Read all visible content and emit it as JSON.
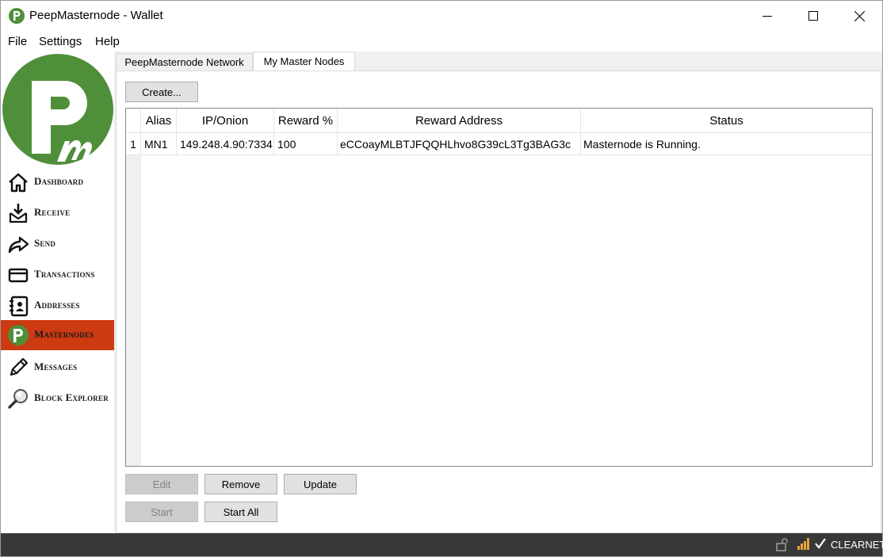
{
  "window": {
    "title": "PeepMasternode - Wallet",
    "controls": {
      "minimize": "minimize-icon",
      "maximize": "maximize-icon",
      "close": "close-icon"
    }
  },
  "menu": {
    "items": [
      "File",
      "Settings",
      "Help"
    ]
  },
  "sidebar": {
    "logo": "pm-logo",
    "items": [
      {
        "label": "Dashboard",
        "icon": "home-icon",
        "active": false
      },
      {
        "label": "Receive",
        "icon": "receive-icon",
        "active": false
      },
      {
        "label": "Send",
        "icon": "send-arrow-icon",
        "active": false
      },
      {
        "label": "Transactions",
        "icon": "card-icon",
        "active": false
      },
      {
        "label": "Addresses",
        "icon": "address-book-icon",
        "active": false
      },
      {
        "label": "Masternodes",
        "icon": "pm-logo-icon",
        "active": true
      },
      {
        "label": "Messages",
        "icon": "pencil-icon",
        "active": false
      },
      {
        "label": "Block Explorer",
        "icon": "magnifier-icon",
        "active": false
      }
    ]
  },
  "tabs": [
    {
      "label": "PeepMasternode Network",
      "selected": false
    },
    {
      "label": "My Master Nodes",
      "selected": true
    }
  ],
  "panel": {
    "create_label": "Create...",
    "table": {
      "columns": [
        "Alias",
        "IP/Onion",
        "Reward %",
        "Reward Address",
        "Status"
      ],
      "rows": [
        {
          "num": "1",
          "alias": "MN1",
          "ip": "149.248.4.90:7334",
          "reward_pct": "100",
          "reward_address": "eCCoayMLBTJFQQHLhvo8G39cL3Tg3BAG3c",
          "status": "Masternode is Running."
        }
      ]
    },
    "buttons": {
      "edit": "Edit",
      "remove": "Remove",
      "update": "Update",
      "start": "Start",
      "start_all": "Start All"
    }
  },
  "statusbar": {
    "network": "CLEARNET",
    "icons": [
      "lock-icon",
      "signal-icon",
      "check-icon"
    ]
  },
  "colors": {
    "brand_green": "#4f8f3a",
    "active_nav": "#cc3a12",
    "statusbar_bg": "#383838"
  }
}
